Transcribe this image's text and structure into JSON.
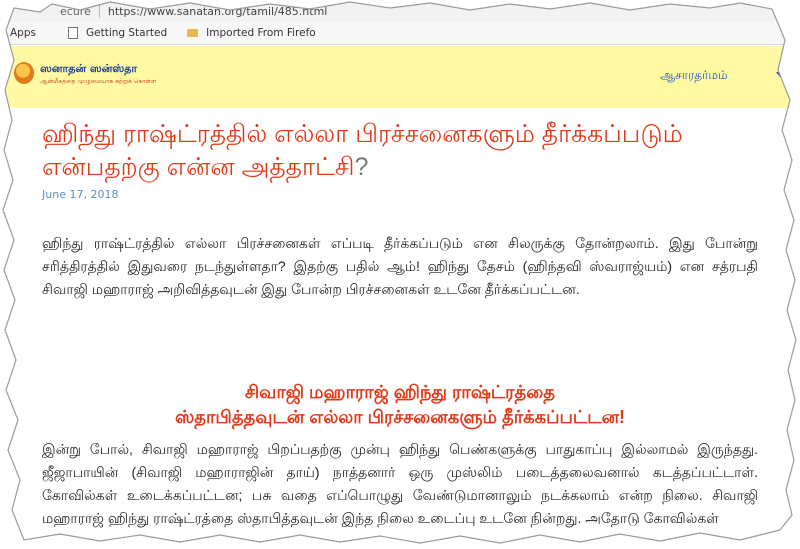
{
  "browser": {
    "secure_label": "ecure",
    "url": "https://www.sanatan.org/tamil/485.html",
    "bookmarks": [
      {
        "label": "Apps",
        "icon": "apps-icon"
      },
      {
        "label": "Getting Started",
        "icon": "page-icon"
      },
      {
        "label": "Imported From Firefo",
        "icon": "folder-icon"
      }
    ]
  },
  "site": {
    "logo_title": "ஸனாதன் ஸன்ஸ்தா",
    "logo_tagline": "ஆன்மீகத்தை முழுமையாக கற்றுக் கொள்ள",
    "nav": [
      "ஆசாரதர்மம்"
    ]
  },
  "article": {
    "title": "ஹிந்து ராஷ்ட்ரத்தில் எல்லா பிரச்சனைகளும் தீர்க்கப்படும் என்பதற்கு என்ன அத்தாட்சி",
    "title_qm": "?",
    "date": "June 17, 2018",
    "para1": "ஹிந்து ராஷ்ட்ரத்தில் எல்லா பிரச்சனைகள் எப்படி தீர்க்கப்படும் என சிலருக்கு தோன்றலாம். இது போன்று சரித்திரத்தில் இதுவரை நடந்துள்ளதா? இதற்கு பதில் ஆம்! ஹிந்து தேசம் (ஹிந்தவி ஸ்வராஜ்யம்) என சத்ரபதி சிவாஜி மஹாராஜ் அறிவித்தவுடன் இது போன்ற பிரச்சனைகள் உடனே தீர்க்கப்பட்டன.",
    "subheading_line1": "சிவாஜி மஹாராஜ் ஹிந்து ராஷ்ட்ரத்தை",
    "subheading_line2": "ஸ்தாபித்தவுடன் எல்லா பிரச்சனைகளும் தீர்க்கப்பட்டன!",
    "para2": "இன்று போல், சிவாஜி மஹாராஜ் பிறப்பதற்கு முன்பு ஹிந்து பெண்களுக்கு பாதுகாப்பு இல்லாமல் இருந்தது. ஜீஜாபாயின் (சிவாஜி மஹாராஜின் தாய்) நாத்தனார் ஒரு முஸ்லிம் படைத்தலைவனால் கடத்தப்பட்டாள். கோவில்கள் உடைக்கப்பட்டன; பசு வதை எப்பொழுது வேண்டுமானாலும் நடக்கலாம் என்ற நிலை. சிவாஜி மஹாராஜ் ஹிந்து ராஷ்ட்ரத்தை ஸ்தாபித்தவுடன் இந்த நிலை உடைப்பு உடனே நின்றது. அதோடு கோவில்கள்"
  },
  "colors": {
    "title": "#e2391a",
    "header_bg": "#fff9a3",
    "link": "#1a56c4",
    "date": "#5b8fc9"
  }
}
